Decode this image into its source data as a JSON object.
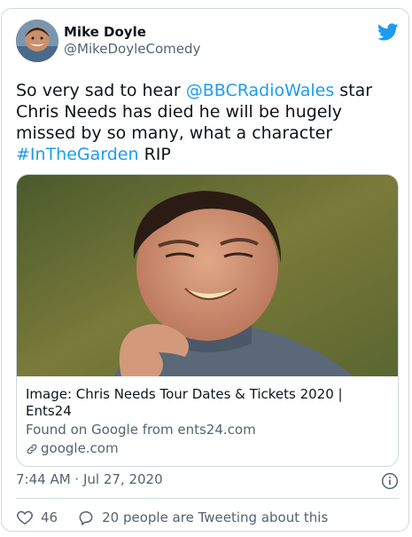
{
  "author": {
    "name": "Mike Doyle",
    "handle": "@MikeDoyleComedy"
  },
  "tweet": {
    "text_parts": [
      {
        "text": "So very sad to hear ",
        "type": "text"
      },
      {
        "text": "@BBCRadioWales",
        "type": "mention"
      },
      {
        "text": " star Chris Needs has died he will be hugely missed by so many, what a character ",
        "type": "text"
      },
      {
        "text": "#InTheGarden",
        "type": "hashtag"
      },
      {
        "text": " RIP",
        "type": "text"
      }
    ]
  },
  "media_card": {
    "title": "Image: Chris Needs Tour Dates & Tickets 2020 | Ents24",
    "source": "Found on Google from ents24.com",
    "domain": "google.com"
  },
  "meta": {
    "timestamp": "7:44 AM · Jul 27, 2020"
  },
  "actions": {
    "likes": "46",
    "retweet_text": "20 people are Tweeting about this"
  },
  "icons": {
    "brand": "twitter-bird-icon",
    "like": "heart-icon",
    "reply": "speech-bubble-icon",
    "info": "info-icon",
    "link": "link-icon"
  },
  "colors": {
    "link": "#1d9bf0",
    "secondary_text": "#536471",
    "border": "#cfd9de"
  }
}
